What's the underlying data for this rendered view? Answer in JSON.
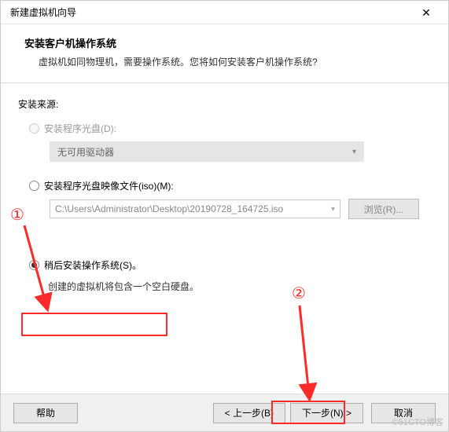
{
  "window": {
    "title": "新建虚拟机向导"
  },
  "header": {
    "title": "安装客户机操作系统",
    "sub": "虚拟机如同物理机，需要操作系统。您将如何安装客户机操作系统?"
  },
  "source_label": "安装来源:",
  "opt_disc": {
    "label": "安装程序光盘(D):"
  },
  "dropdown": {
    "placeholder": "无可用驱动器"
  },
  "opt_iso": {
    "label": "安装程序光盘映像文件(iso)(M):"
  },
  "iso_path": "C:\\Users\\Administrator\\Desktop\\20190728_164725.iso",
  "browse_label": "浏览(R)...",
  "opt_later": {
    "label": "稍后安装操作系统(S)。"
  },
  "later_desc": "创建的虚拟机将包含一个空白硬盘。",
  "footer": {
    "help": "帮助",
    "back": "< 上一步(B)",
    "next": "下一步(N) >",
    "cancel": "取消"
  },
  "annot": {
    "one": "①",
    "two": "②"
  },
  "watermark": "©51CTO博客"
}
